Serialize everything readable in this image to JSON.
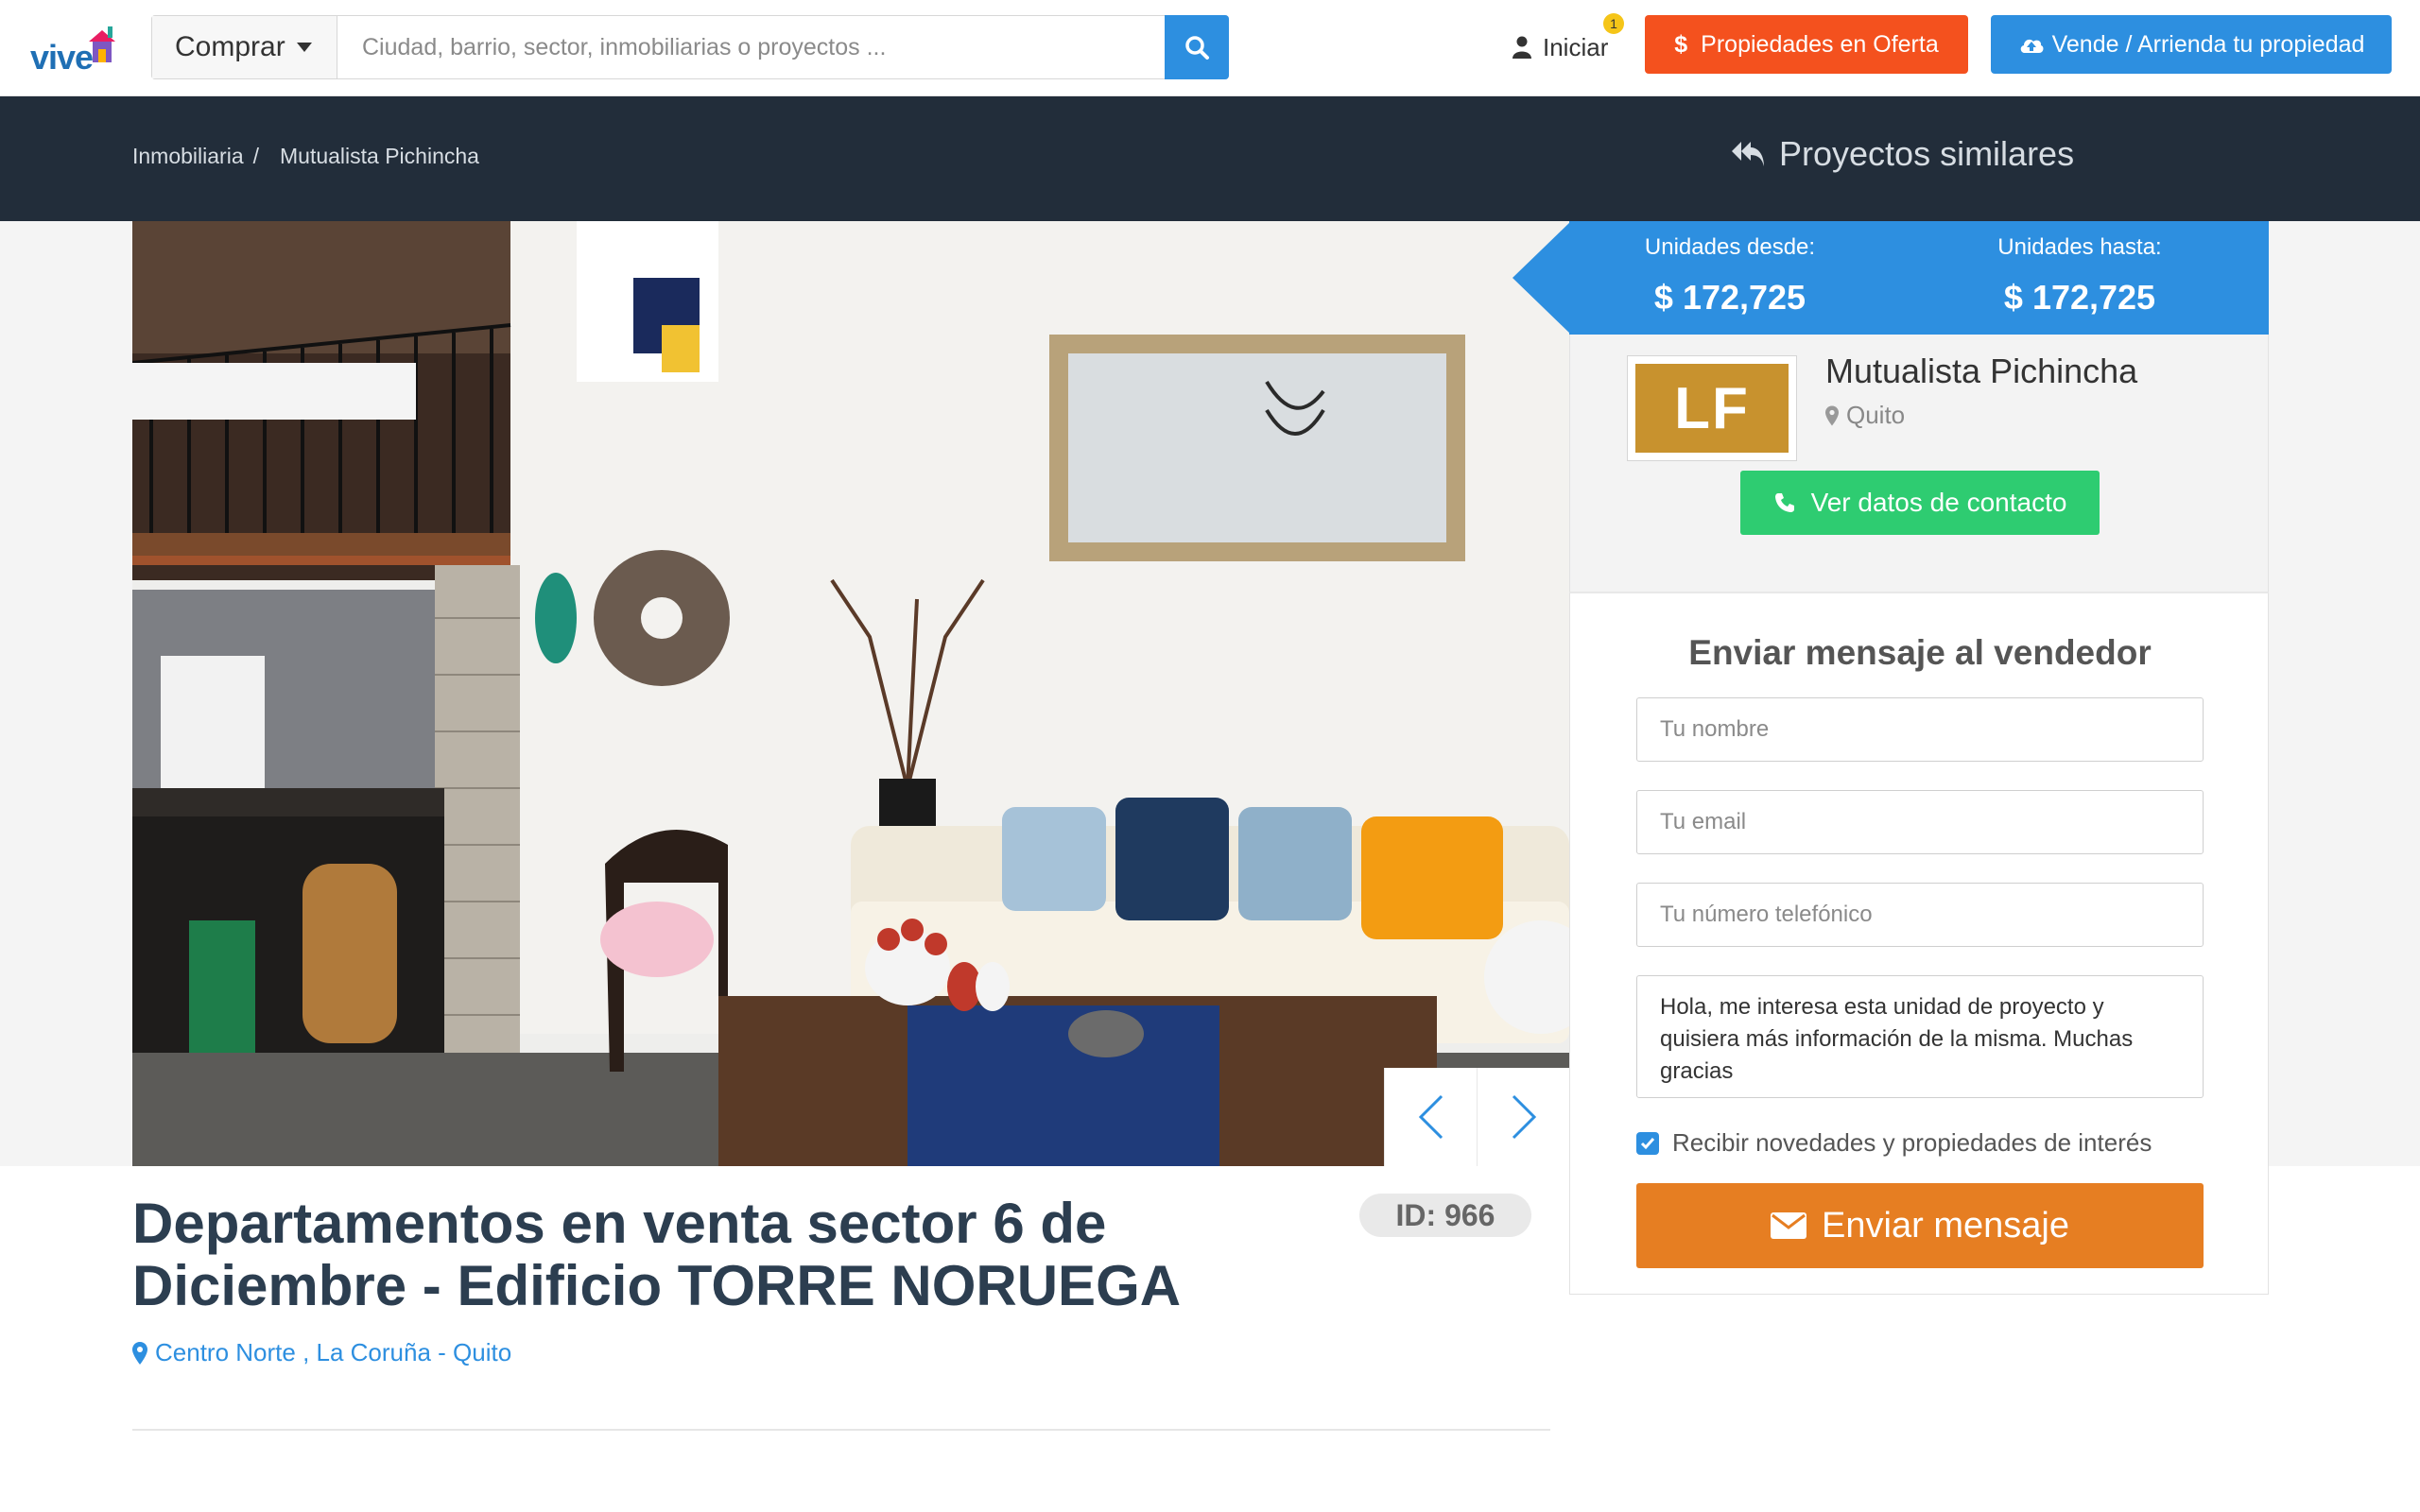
{
  "header": {
    "logo_text": "vive",
    "search_mode": "Comprar",
    "search_placeholder": "Ciudad, barrio, sector, inmobiliarias o proyectos ...",
    "login_label": "Iniciar",
    "login_badge": "1",
    "oferta_label": "Propiedades en Oferta",
    "vende_label": "Vende / Arrienda tu propiedad"
  },
  "band": {
    "breadcrumb": [
      "Inmobiliaria",
      "/",
      "Mutualista Pichincha"
    ],
    "similar_label": "Proyectos similares"
  },
  "listing": {
    "title": "Departamentos en venta sector 6 de Diciembre - Edificio TORRE NORUEGA",
    "id_badge": "ID: 966",
    "location": "Centro Norte , La Coruña - Quito"
  },
  "prices": {
    "from_label": "Unidades desde:",
    "from_value": "$ 172,725",
    "to_label": "Unidades hasta:",
    "to_value": "$ 172,725"
  },
  "developer": {
    "logo_text": "LF",
    "name": "Mutualista Pichincha",
    "city": "Quito",
    "contact_label": "Ver datos de contacto"
  },
  "form": {
    "title": "Enviar mensaje al vendedor",
    "name_placeholder": "Tu nombre",
    "email_placeholder": "Tu email",
    "phone_placeholder": "Tu número telefónico",
    "message": "Hola, me interesa esta unidad de proyecto y quisiera más información de la misma. Muchas gracias",
    "newsletter_label": "Recibir novedades y propiedades de interés",
    "newsletter_checked": true,
    "send_label": "Enviar mensaje"
  },
  "colors": {
    "primary": "#2d8fe0",
    "offer": "#f4511e",
    "dark_band": "#222d3a",
    "contact": "#2ecc71",
    "send": "#e67e22"
  }
}
